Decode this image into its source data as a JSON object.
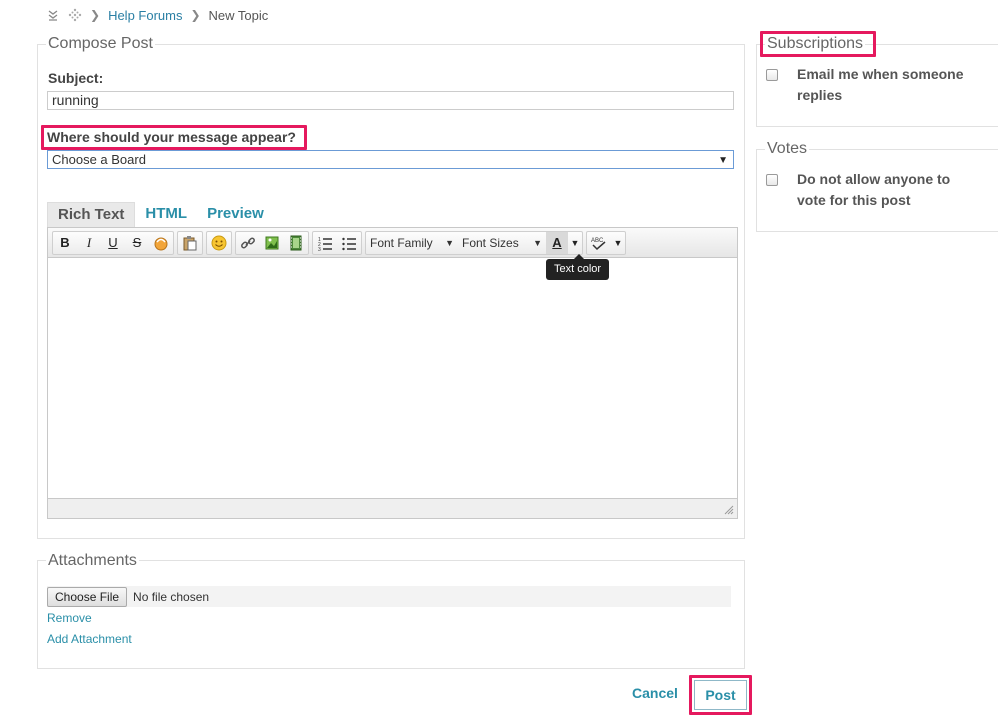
{
  "breadcrumb": {
    "items": [
      "Help Forums",
      "New Topic"
    ]
  },
  "compose": {
    "legend": "Compose Post",
    "subject_label": "Subject:",
    "subject_value": "running",
    "board_label": "Where should your message appear?",
    "board_selected": "Choose a Board"
  },
  "editor": {
    "tabs": [
      "Rich Text",
      "HTML",
      "Preview"
    ],
    "active_tab": "Rich Text",
    "font_family_label": "Font Family",
    "font_sizes_label": "Font Sizes",
    "tooltip": "Text color",
    "toolbar_icons": [
      "bold-icon",
      "italic-icon",
      "underline-icon",
      "strikethrough-icon",
      "clear-format-icon",
      "paste-icon",
      "emoji-icon",
      "link-icon",
      "image-icon",
      "video-icon",
      "ordered-list-icon",
      "unordered-list-icon",
      "text-color-icon",
      "spellcheck-icon"
    ]
  },
  "attachments": {
    "legend": "Attachments",
    "choose_file": "Choose File",
    "no_file": "No file chosen",
    "remove": "Remove",
    "add": "Add Attachment"
  },
  "subscriptions": {
    "legend": "Subscriptions",
    "option_line1": "Email me when someone",
    "option_line2": "replies"
  },
  "votes": {
    "legend": "Votes",
    "option_line1": "Do not allow anyone to",
    "option_line2": "vote for this post"
  },
  "actions": {
    "cancel": "Cancel",
    "post": "Post"
  },
  "colors": {
    "link": "#2a8fa8",
    "highlight": "#e5195e"
  }
}
